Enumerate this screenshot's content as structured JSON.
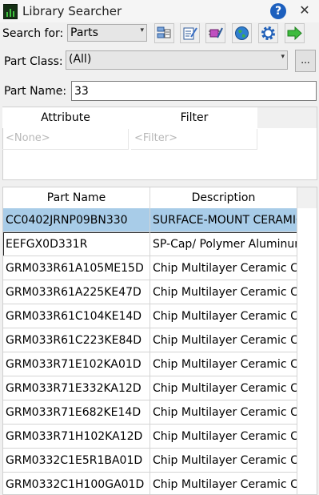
{
  "window": {
    "title": "Library Searcher",
    "help_label": "?",
    "close_label": "✕"
  },
  "search_for": {
    "label": "Search for:",
    "value": "Parts"
  },
  "toolbar": {
    "icons": [
      "parts-search-icon",
      "edit-list-icon",
      "component-icon",
      "globe-icon",
      "settings-gear-icon",
      "green-arrow-icon"
    ]
  },
  "part_class": {
    "label": "Part Class:",
    "value": "(All)",
    "browse_label": "..."
  },
  "part_name": {
    "label": "Part Name:",
    "value": "33"
  },
  "attributes": {
    "headers": [
      "Attribute",
      "Filter"
    ],
    "row": {
      "attribute_placeholder": "<None>",
      "filter_placeholder": "<Filter>"
    }
  },
  "results": {
    "headers": [
      "Part Name",
      "Description"
    ],
    "rows": [
      {
        "part_name": "CC0402JRNP09BN330",
        "description": "SURFACE-MOUNT CERAMIC",
        "selected": true
      },
      {
        "part_name": "EEFGX0D331R",
        "description": "SP-Cap/ Polymer Aluminum",
        "focused": true
      },
      {
        "part_name": "GRM033R61A105ME15D",
        "description": "Chip Multilayer Ceramic Capacitor"
      },
      {
        "part_name": "GRM033R61A225KE47D",
        "description": "Chip Multilayer Ceramic Capacitor"
      },
      {
        "part_name": "GRM033R61C104KE14D",
        "description": "Chip Multilayer Ceramic Capacitor"
      },
      {
        "part_name": "GRM033R61C223KE84D",
        "description": "Chip Multilayer Ceramic Capacitor"
      },
      {
        "part_name": "GRM033R71E102KA01D",
        "description": "Chip Multilayer Ceramic Capacitor"
      },
      {
        "part_name": "GRM033R71E332KA12D",
        "description": "Chip Multilayer Ceramic Capacitor"
      },
      {
        "part_name": "GRM033R71E682KE14D",
        "description": "Chip Multilayer Ceramic Capacitor"
      },
      {
        "part_name": "GRM033R71H102KA12D",
        "description": "Chip Multilayer Ceramic Capacitor"
      },
      {
        "part_name": "GRM0332C1E5R1BA01D",
        "description": "Chip Multilayer Ceramic Capacitor"
      },
      {
        "part_name": "GRM0332C1H100GA01D",
        "description": "Chip Multilayer Ceramic Capacitor"
      }
    ]
  }
}
